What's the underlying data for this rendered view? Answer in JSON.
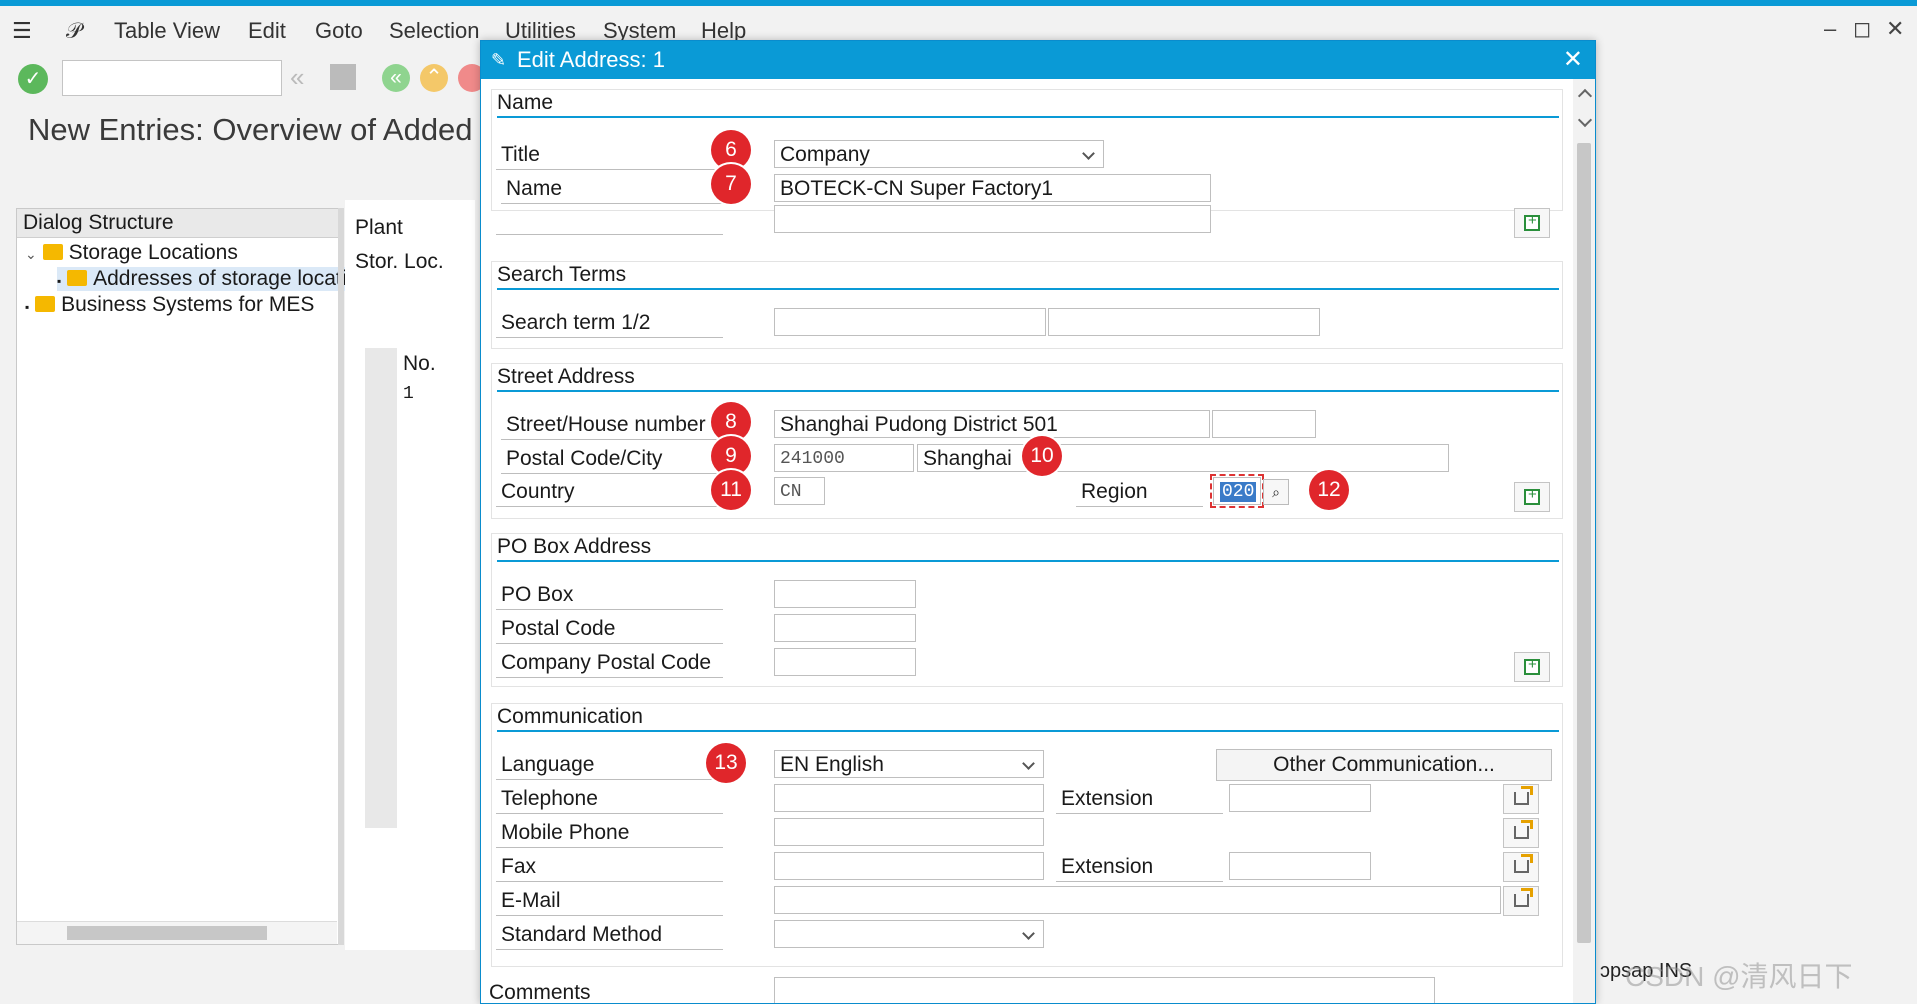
{
  "menubar": {
    "items": [
      "Table View",
      "Edit",
      "Goto",
      "Selection",
      "Utilities",
      "System",
      "Help"
    ]
  },
  "page": {
    "title": "New Entries: Overview of Added"
  },
  "dialog_structure": {
    "header": "Dialog Structure",
    "items": [
      "Storage Locations",
      "Addresses of storage locati",
      "Business Systems for MES"
    ]
  },
  "main": {
    "plant_label": "Plant",
    "storloc_label": "Stor. Loc.",
    "col_no": "No.",
    "row_value": "1"
  },
  "dialog": {
    "title": "Edit Address:  1",
    "sections": {
      "name": "Name",
      "search": "Search Terms",
      "street": "Street Address",
      "pobox": "PO Box Address",
      "comm": "Communication",
      "comments": "Comments"
    },
    "fields": {
      "title_label": "Title",
      "title_value": "Company",
      "name_label": "Name",
      "name_value": "BOTECK-CN Super Factory1",
      "search_label": "Search term 1/2",
      "street_label": "Street/House number",
      "street_value": "Shanghai Pudong District 501",
      "postal_label": "Postal Code/City",
      "postal_value": "241000",
      "city_value": "Shanghai",
      "country_label": "Country",
      "country_value": "CN",
      "region_label": "Region",
      "region_value": "020",
      "pobox_label": "PO Box",
      "pobox_postal_label": "Postal Code",
      "company_postal_label": "Company Postal Code",
      "language_label": "Language",
      "language_value": "EN English",
      "other_comm": "Other Communication...",
      "telephone_label": "Telephone",
      "extension_label": "Extension",
      "mobile_label": "Mobile Phone",
      "fax_label": "Fax",
      "fax_ext_label": "Extension",
      "email_label": "E-Mail",
      "std_method_label": "Standard Method"
    },
    "badges": [
      "6",
      "7",
      "8",
      "9",
      "10",
      "11",
      "12",
      "13"
    ]
  },
  "status": {
    "text": "ɔpsap  INS"
  },
  "watermark": "CSDN @清风日下"
}
